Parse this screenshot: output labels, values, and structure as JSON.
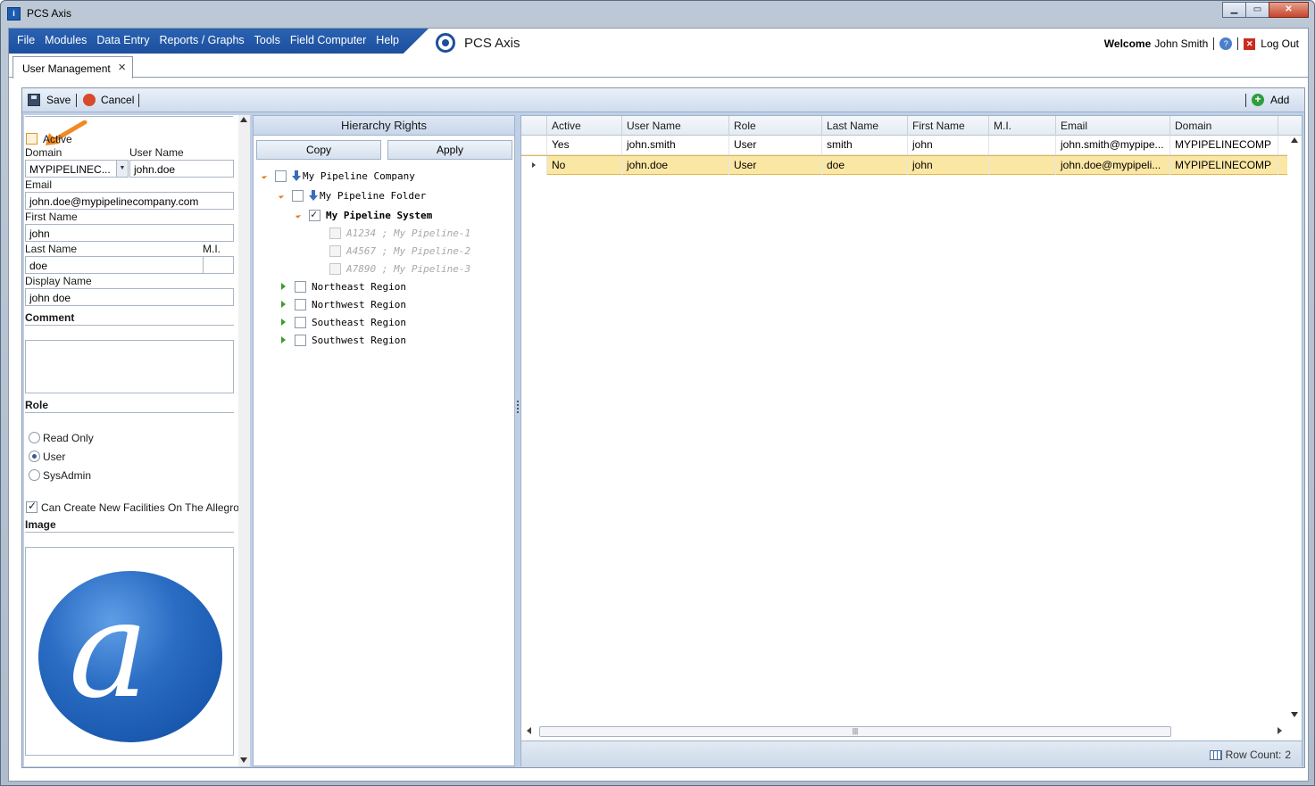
{
  "window": {
    "title": "PCS Axis"
  },
  "menu": {
    "items": [
      "File",
      "Modules",
      "Data Entry",
      "Reports / Graphs",
      "Tools",
      "Field Computer",
      "Help"
    ],
    "brand": "PCS Axis"
  },
  "header": {
    "welcome_label": "Welcome",
    "user_name": "John Smith",
    "logout_label": "Log Out"
  },
  "tab": {
    "label": "User Management"
  },
  "toolbar": {
    "save_label": "Save",
    "cancel_label": "Cancel",
    "add_label": "Add"
  },
  "form": {
    "active_label": "Active",
    "active_checked": false,
    "domain_label": "Domain",
    "domain_value": "MYPIPELINEC...",
    "username_label": "User Name",
    "username_value": "john.doe",
    "email_label": "Email",
    "email_value": "john.doe@mypipelinecompany.com",
    "first_name_label": "First Name",
    "first_name_value": "john",
    "last_name_label": "Last Name",
    "last_name_value": "doe",
    "mi_label": "M.I.",
    "mi_value": "",
    "display_name_label": "Display Name",
    "display_name_value": "john doe",
    "comment_label": "Comment",
    "comment_value": "",
    "role_label": "Role",
    "roles": [
      "Read Only",
      "User",
      "SysAdmin"
    ],
    "selected_role": "User",
    "create_facilities_label": "Can Create New Facilities On The Allegro",
    "create_facilities_checked": true,
    "image_label": "Image"
  },
  "hierarchy": {
    "title": "Hierarchy Rights",
    "copy_label": "Copy",
    "apply_label": "Apply",
    "nodes": [
      {
        "label": "My Pipeline Company",
        "checked": false
      },
      {
        "label": "My Pipeline Folder",
        "checked": false
      },
      {
        "label": "My Pipeline System",
        "checked": true
      },
      {
        "label": "A1234 ; My Pipeline-1",
        "checked": false
      },
      {
        "label": "A4567 ; My Pipeline-2",
        "checked": false
      },
      {
        "label": "A7890 ; My Pipeline-3",
        "checked": false
      },
      {
        "label": "Northeast Region",
        "checked": false
      },
      {
        "label": "Northwest Region",
        "checked": false
      },
      {
        "label": "Southeast Region",
        "checked": false
      },
      {
        "label": "Southwest Region",
        "checked": false
      }
    ]
  },
  "grid": {
    "columns": [
      "Active",
      "User Name",
      "Role",
      "Last Name",
      "First Name",
      "M.I.",
      "Email",
      "Domain"
    ],
    "rows": [
      [
        "Yes",
        "john.smith",
        "User",
        "smith",
        "john",
        "",
        "john.smith@mypipe...",
        "MYPIPELINECOMP"
      ],
      [
        "No",
        "john.doe",
        "User",
        "doe",
        "john",
        "",
        "john.doe@mypipeli...",
        "MYPIPELINECOMP"
      ]
    ],
    "selected_row": 1,
    "row_count_label": "Row Count:",
    "row_count": "2"
  },
  "colors": {
    "menu_blue": "#1d4f9e",
    "selected_row": "#fbe7a4",
    "accent_orange": "#f08a24"
  }
}
